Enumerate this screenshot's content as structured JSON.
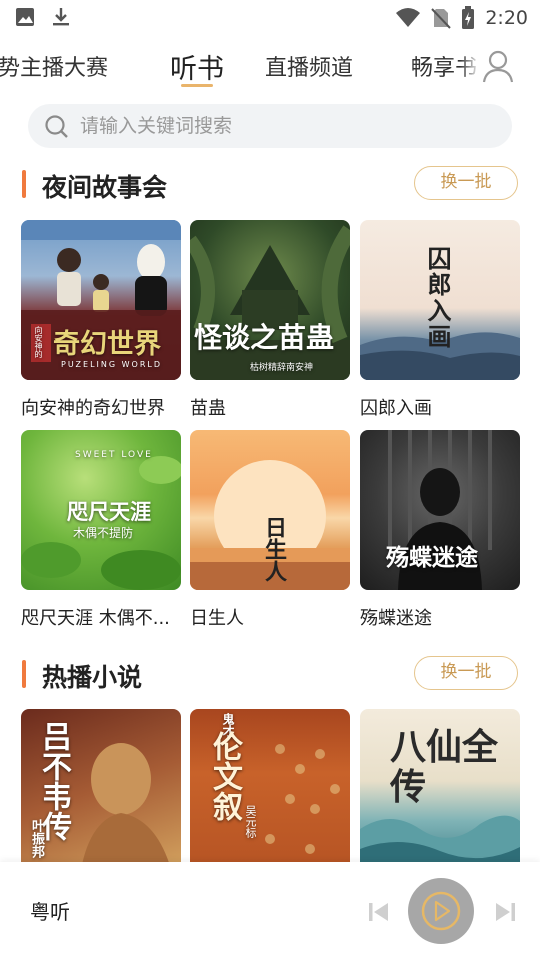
{
  "status_bar": {
    "time": "2:20",
    "icons": [
      "image-icon",
      "download-icon",
      "wifi-icon",
      "no-sim-icon",
      "battery-charging-icon"
    ]
  },
  "tabs": [
    {
      "label": "趋势主播大赛",
      "active": false
    },
    {
      "label": "听书",
      "active": true
    },
    {
      "label": "直播频道",
      "active": false
    },
    {
      "label": "畅享书",
      "active": false
    }
  ],
  "search": {
    "placeholder": "请输入关键词搜索"
  },
  "sections": [
    {
      "title": "夜间故事会",
      "refresh_label": "换一批",
      "items": [
        {
          "title": "向安神的奇幻世界",
          "cover_text": "奇幻世界",
          "cover_sub": "PUZELING WORLD",
          "cover_tag": "向安神的"
        },
        {
          "title": "苗蛊",
          "cover_text": "怪谈之苗蛊",
          "cover_sub": "枯树精辞南安神"
        },
        {
          "title": "囚郎入画",
          "cover_text": "囚郎入画"
        },
        {
          "title": "咫尺天涯 木偶不...",
          "cover_text": "咫尺天涯",
          "cover_sub": "木偶不提防",
          "cover_tag": "SWEET LOVE"
        },
        {
          "title": "日生人",
          "cover_text": "日生人"
        },
        {
          "title": "殇蝶迷途",
          "cover_text": "殇蝶迷途"
        }
      ]
    },
    {
      "title": "热播小说",
      "refresh_label": "换一批",
      "items": [
        {
          "cover_text": "吕不韦传",
          "cover_sub": "叶振邦"
        },
        {
          "cover_text": "伦文叙",
          "cover_sub": "鬼才",
          "cover_tag": "吴元标"
        },
        {
          "cover_text": "八仙全传"
        }
      ]
    }
  ],
  "player": {
    "title": "粤听"
  },
  "colors": {
    "accent": "#f07a3e",
    "gold": "#e9b46b",
    "search_bg": "#f1f3f5",
    "player_button": "#a7a7a7"
  }
}
